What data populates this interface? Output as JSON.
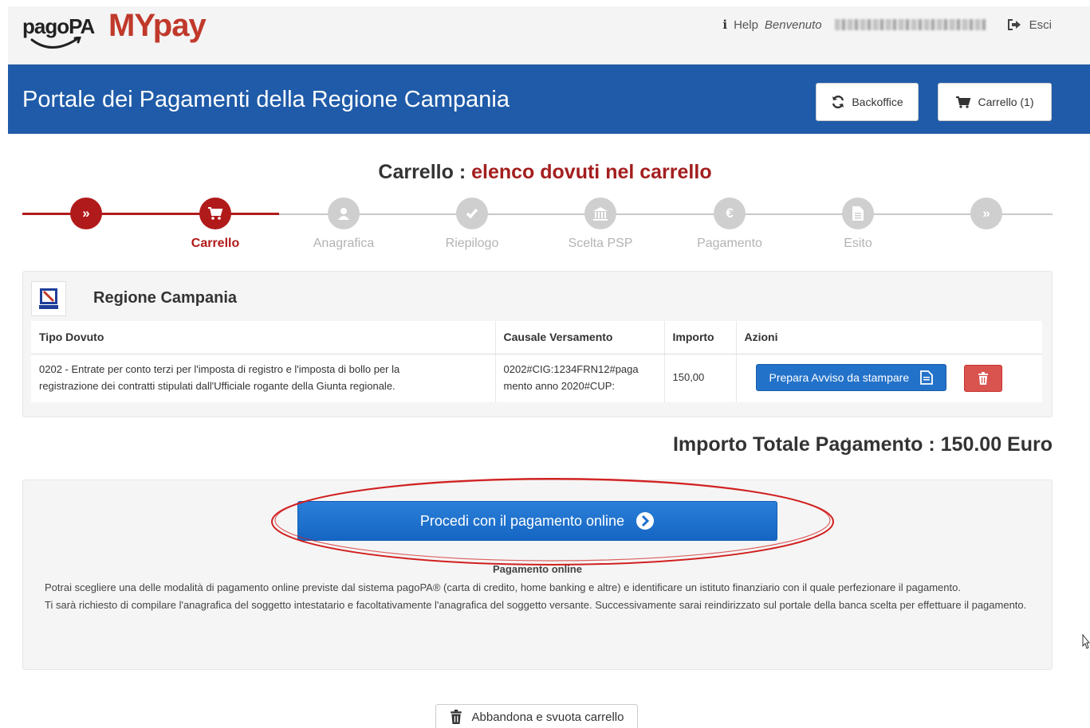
{
  "header": {
    "logo_pagopa": "pagoPA",
    "logo_mypay_my": "MY",
    "logo_mypay_pay": "pay",
    "help_label": "Help",
    "welcome_label": "Benvenuto",
    "logout_label": "Esci"
  },
  "bluebar": {
    "title": "Portale dei Pagamenti della Regione Campania",
    "backoffice_label": "Backoffice",
    "cart_label": "Carrello (1)"
  },
  "heading": {
    "main": "Carrello :",
    "sub": "elenco dovuti nel carrello"
  },
  "steps": [
    {
      "label": "",
      "icon": "double-chevron-icon",
      "active": true
    },
    {
      "label": "Carrello",
      "icon": "cart-icon",
      "active": true
    },
    {
      "label": "Anagrafica",
      "icon": "user-icon",
      "active": false
    },
    {
      "label": "Riepilogo",
      "icon": "check-icon",
      "active": false
    },
    {
      "label": "Scelta PSP",
      "icon": "bank-icon",
      "active": false
    },
    {
      "label": "Pagamento",
      "icon": "euro-icon",
      "active": false
    },
    {
      "label": "Esito",
      "icon": "document-icon",
      "active": false
    },
    {
      "label": "",
      "icon": "double-chevron-icon",
      "active": false
    }
  ],
  "ente": {
    "name": "Regione Campania"
  },
  "table": {
    "headers": [
      "Tipo Dovuto",
      "Causale Versamento",
      "Importo",
      "Azioni"
    ],
    "rows": [
      {
        "tipo_line1": "0202 - Entrate per conto terzi per l'imposta di registro e l'imposta di bollo per la",
        "tipo_line2": "registrazione dei contratti stipulati dall'Ufficiale rogante della Giunta regionale.",
        "causale_line1": "0202#CIG:1234FRN12#paga",
        "causale_line2": "mento anno 2020#CUP:",
        "importo": "150,00",
        "avviso_label": "Prepara Avviso da stampare"
      }
    ]
  },
  "totale": "Importo Totale Pagamento : 150.00 Euro",
  "proceed": {
    "button_label": "Procedi con il pagamento online",
    "sub_label": "Pagamento online",
    "text_line1": "Potrai scegliere una delle modalità di pagamento online previste dal sistema pagoPA® (carta di credito, home banking e altre) e identificare un istituto finanziario con il quale perfezionare il pagamento.",
    "text_line2": "Ti sarà richiesto di compilare l'anagrafica del soggetto intestatario e facoltativamente l'anagrafica del soggetto versante. Successivamente sarai reindirizzato sul portale della banca scelta per effettuare il pagamento."
  },
  "abbandona_label": "Abbandona e svuota carrello",
  "colors": {
    "brand_blue": "#1f5ba8",
    "accent_red": "#b11a1a",
    "button_blue": "#2372c9",
    "danger_red": "#d9534f"
  }
}
